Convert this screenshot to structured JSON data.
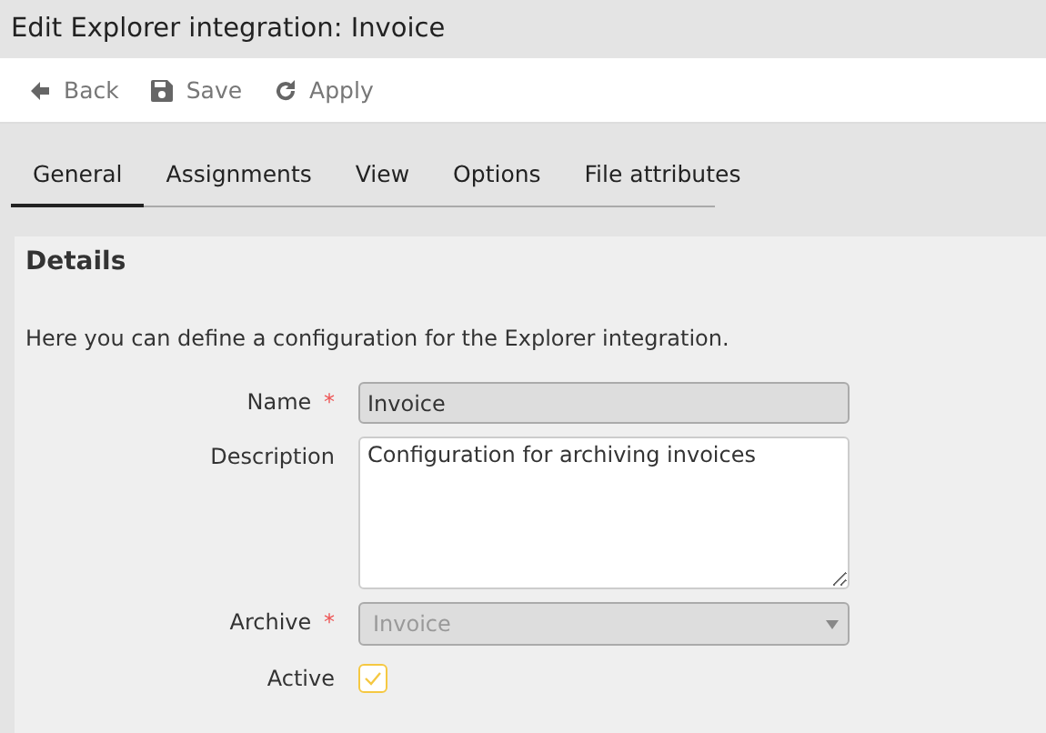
{
  "window": {
    "title": "Edit Explorer integration: Invoice"
  },
  "toolbar": [
    {
      "label": "Back",
      "kind": "back"
    },
    {
      "label": "Save",
      "kind": "save"
    },
    {
      "label": "Apply",
      "kind": "apply"
    }
  ],
  "tabs": [
    {
      "label": "General",
      "selected": true
    },
    {
      "label": "Assignments",
      "selected": false
    },
    {
      "label": "View",
      "selected": false
    },
    {
      "label": "Options",
      "selected": false
    },
    {
      "label": "File attributes",
      "selected": false
    }
  ],
  "panel": {
    "title": "Details",
    "intro": "Here you can define a configuration for the Explorer integration.",
    "fields": [
      {
        "kind": "text",
        "label": "Name",
        "required": "*",
        "value": "Invoice",
        "disabled": true
      },
      {
        "kind": "textarea",
        "label": "Description",
        "value": "Configuration for archiving invoices",
        "disabled": false
      },
      {
        "kind": "select",
        "label": "Archive",
        "required": "*",
        "value": "Invoice",
        "disabled": true
      },
      {
        "kind": "checkbox",
        "label": "Active",
        "checked": true,
        "disabled": false
      }
    ]
  }
}
